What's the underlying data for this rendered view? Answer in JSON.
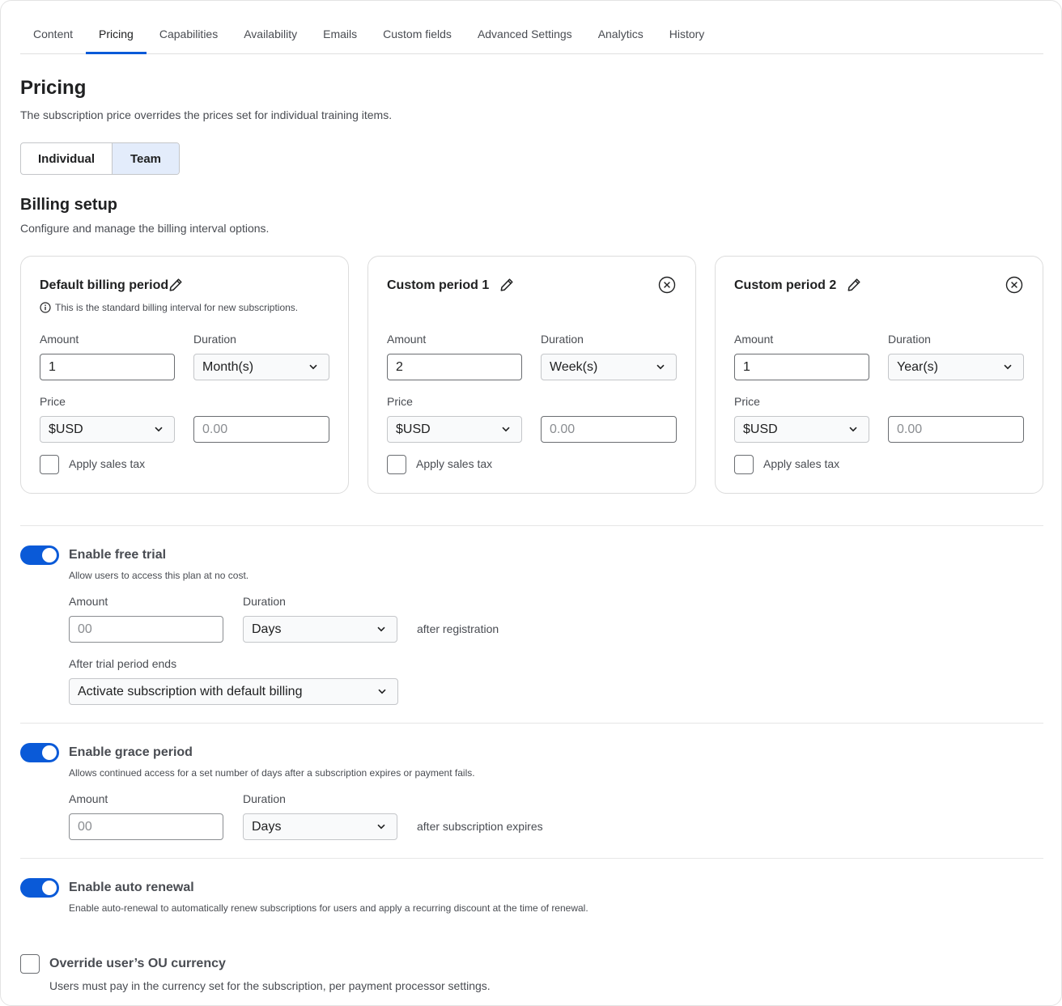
{
  "tabs": [
    {
      "label": "Content"
    },
    {
      "label": "Pricing",
      "active": true
    },
    {
      "label": "Capabilities"
    },
    {
      "label": "Availability"
    },
    {
      "label": "Emails"
    },
    {
      "label": "Custom fields"
    },
    {
      "label": "Advanced Settings"
    },
    {
      "label": "Analytics"
    },
    {
      "label": "History"
    }
  ],
  "pricing": {
    "title": "Pricing",
    "description": "The subscription price overrides the prices set for individual training items.",
    "segment": {
      "individual": "Individual",
      "team": "Team",
      "selected": "Team"
    }
  },
  "billing": {
    "title": "Billing setup",
    "description": "Configure and manage the billing interval options.",
    "labels": {
      "amount": "Amount",
      "duration": "Duration",
      "price": "Price",
      "tax": "Apply sales tax"
    },
    "cards": [
      {
        "title": "Default billing period",
        "note": "This is the standard billing interval for new subscriptions.",
        "amount": "1",
        "duration": "Month(s)",
        "currency": "$USD",
        "price_placeholder": "0.00",
        "tax_checked": false
      },
      {
        "title": "Custom period 1",
        "amount": "2",
        "duration": "Week(s)",
        "currency": "$USD",
        "price_placeholder": "0.00",
        "tax_checked": false
      },
      {
        "title": "Custom period 2",
        "amount": "1",
        "duration": "Year(s)",
        "currency": "$USD",
        "price_placeholder": "0.00",
        "tax_checked": false
      }
    ]
  },
  "free_trial": {
    "enabled": true,
    "title": "Enable free trial",
    "description": "Allow users to access this plan at no cost.",
    "amount_label": "Amount",
    "amount_placeholder": "00",
    "duration_label": "Duration",
    "duration": "Days",
    "suffix": "after registration",
    "after_label": "After trial period ends",
    "after_value": "Activate subscription with default billing"
  },
  "grace": {
    "enabled": true,
    "title": "Enable grace period",
    "description": "Allows continued access for a set number of days after a subscription expires or payment fails.",
    "amount_label": "Amount",
    "amount_placeholder": "00",
    "duration_label": "Duration",
    "duration": "Days",
    "suffix": "after subscription expires"
  },
  "auto_renewal": {
    "enabled": true,
    "title": "Enable auto renewal",
    "description": "Enable auto-renewal to automatically renew subscriptions for users and apply a recurring discount at the time of renewal."
  },
  "override": {
    "checked": false,
    "title": "Override user’s OU currency",
    "description": "Users must pay in the currency set for the subscription, per payment processor settings."
  },
  "colors": {
    "accent": "#0a5ad8",
    "segment_selected": "#e3ecfb"
  }
}
